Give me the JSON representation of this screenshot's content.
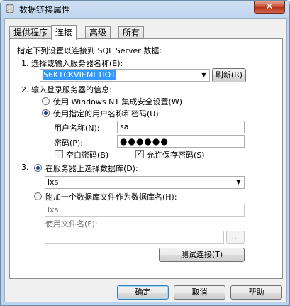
{
  "window": {
    "title": "数据链接属性",
    "close_glyph": "✕"
  },
  "tabs": [
    {
      "label": "提供程序"
    },
    {
      "label": "连接"
    },
    {
      "label": "高级"
    },
    {
      "label": "所有"
    }
  ],
  "connection": {
    "intro": "指定下列设置以连接到 SQL Server 数据:",
    "step1_label": "1. 选择或输入服务器名称(E):",
    "server_value": "56K1CKVIEML1IOT",
    "refresh_label": "刷新(R)",
    "step2_label": "2. 输入登录服务器的信息:",
    "windows_auth_label": "使用 Windows NT 集成安全设置(W)",
    "sql_auth_label": "使用指定的用户名称和密码(U):",
    "username_label": "用户名称(N):",
    "username_value": "sa",
    "password_label": "密码(P):",
    "password_mask": "●●●●●●",
    "blank_password_label": "空白密码(B)",
    "allow_save_password_label": "允许保存密码(S)",
    "step3_number": "3.",
    "select_db_label": "在服务器上选择数据库(D):",
    "database_value": "lxs",
    "attach_db_label": "附加一个数据库文件作为数据库名(H):",
    "attach_name_value": "lxs",
    "use_filename_label": "使用文件名(F):",
    "browse_label": "...",
    "test_label": "测试连接(T)"
  },
  "footer": {
    "ok_label": "确定",
    "cancel_label": "取消",
    "help_label": "帮助"
  },
  "state": {
    "auth_mode": "sql",
    "blank_password": false,
    "allow_save_password": true,
    "db_mode": "select"
  }
}
